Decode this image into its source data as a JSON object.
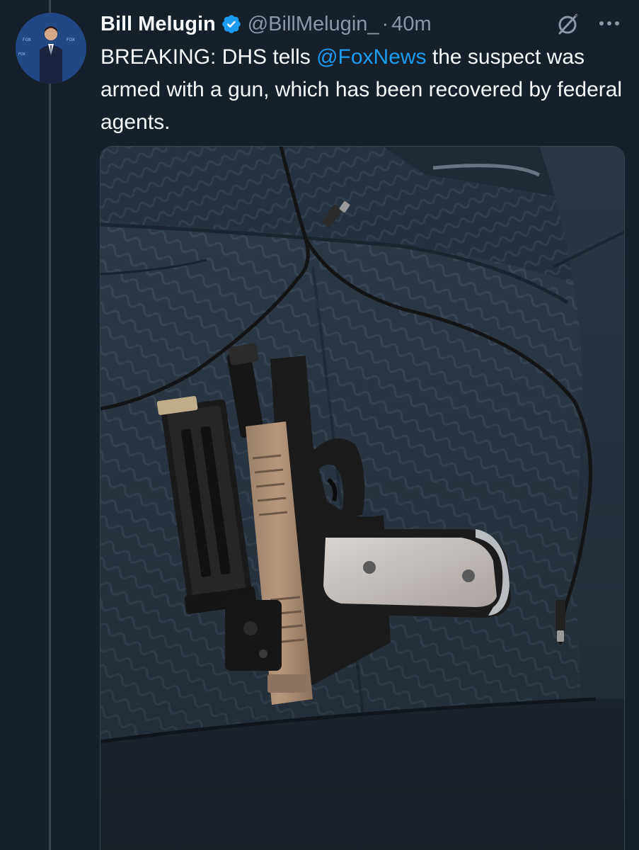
{
  "tweet": {
    "display_name": "Bill Melugin",
    "handle": "@BillMelugin_",
    "separator": "·",
    "time": "40m",
    "text_before": "BREAKING: DHS tells ",
    "mention": "@FoxNews",
    "text_after": " the suspect was armed with a gun, which has been recovered by federal agents."
  },
  "icons": {
    "verified": "verified-badge-icon",
    "grok": "grok-icon",
    "more": "more-options-icon"
  },
  "colors": {
    "background": "#15202b",
    "accent": "#1d9bf0",
    "secondary_text": "#8b98a5",
    "primary_text": "#f7f9f9"
  },
  "media": {
    "type": "photo"
  }
}
